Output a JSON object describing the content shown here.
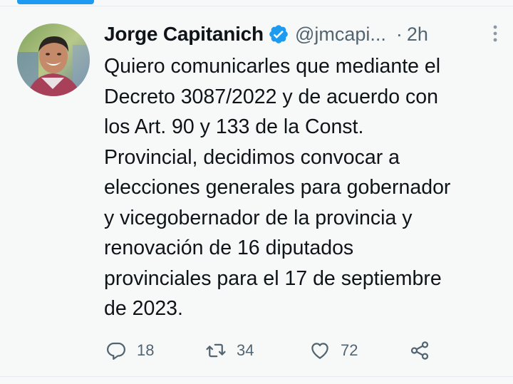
{
  "tweet": {
    "author": {
      "display_name": "Jorge Capitanich",
      "handle": "@jmcapi...",
      "verified": true
    },
    "separator": "·",
    "timestamp": "2h",
    "lines": [
      "Quiero comunicarles que mediante el",
      "Decreto 3087/2022 y de acuerdo con",
      "los Art. 90 y 133 de la Const.",
      "Provincial, decidimos convocar a",
      "elecciones generales para gobernador",
      "y vicegobernador de la provincia y",
      "renovación de 16 diputados",
      "provinciales para el 17 de septiembre",
      "de 2023."
    ],
    "actions": {
      "replies": "18",
      "retweets": "34",
      "likes": "72"
    }
  },
  "colors": {
    "accent": "#1d9bf0",
    "text": "#0f1419",
    "secondary": "#536471",
    "background": "#f7f9f9"
  },
  "icons": [
    "verified-icon",
    "more-icon",
    "reply-icon",
    "retweet-icon",
    "like-icon",
    "share-icon"
  ]
}
